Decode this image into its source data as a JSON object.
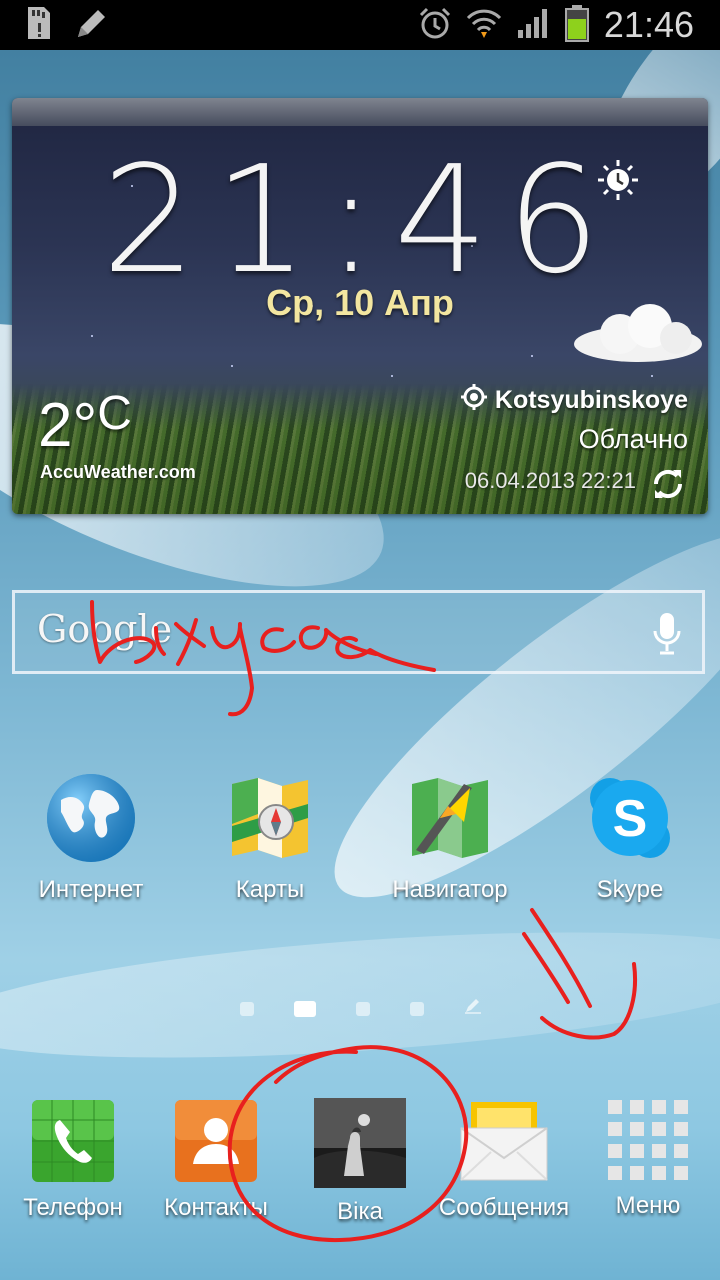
{
  "status_bar": {
    "time": "21:46",
    "icons": [
      "sd-card-icon",
      "pencil-icon",
      "alarm-icon",
      "wifi-icon",
      "signal-icon",
      "battery-icon"
    ]
  },
  "clock_widget": {
    "time": "21:46",
    "date": "Ср, 10 Апр",
    "temperature": "2°",
    "temperature_unit": "C",
    "provider": "AccuWeather.com",
    "location": "Kotsyubinskoye",
    "condition": "Облачно",
    "updated": "06.04.2013 22:21"
  },
  "search_bar": {
    "logo": "Google"
  },
  "apps": [
    {
      "label": "Интернет",
      "icon": "globe-icon"
    },
    {
      "label": "Карты",
      "icon": "maps-icon"
    },
    {
      "label": "Навигатор",
      "icon": "navigator-icon"
    },
    {
      "label": "Skype",
      "icon": "skype-icon"
    }
  ],
  "page_indicator": {
    "pages": 5,
    "active": 1
  },
  "dock": [
    {
      "label": "Телефон",
      "icon": "phone-icon"
    },
    {
      "label": "Контакты",
      "icon": "contacts-icon"
    },
    {
      "label": "Віка",
      "icon": "photo-icon"
    },
    {
      "label": "Сообщения",
      "icon": "messages-icon"
    },
    {
      "label": "Меню",
      "icon": "menu-grid-icon"
    }
  ],
  "annotation": {
    "handwriting": "Віkусся",
    "color": "#e8201e"
  }
}
